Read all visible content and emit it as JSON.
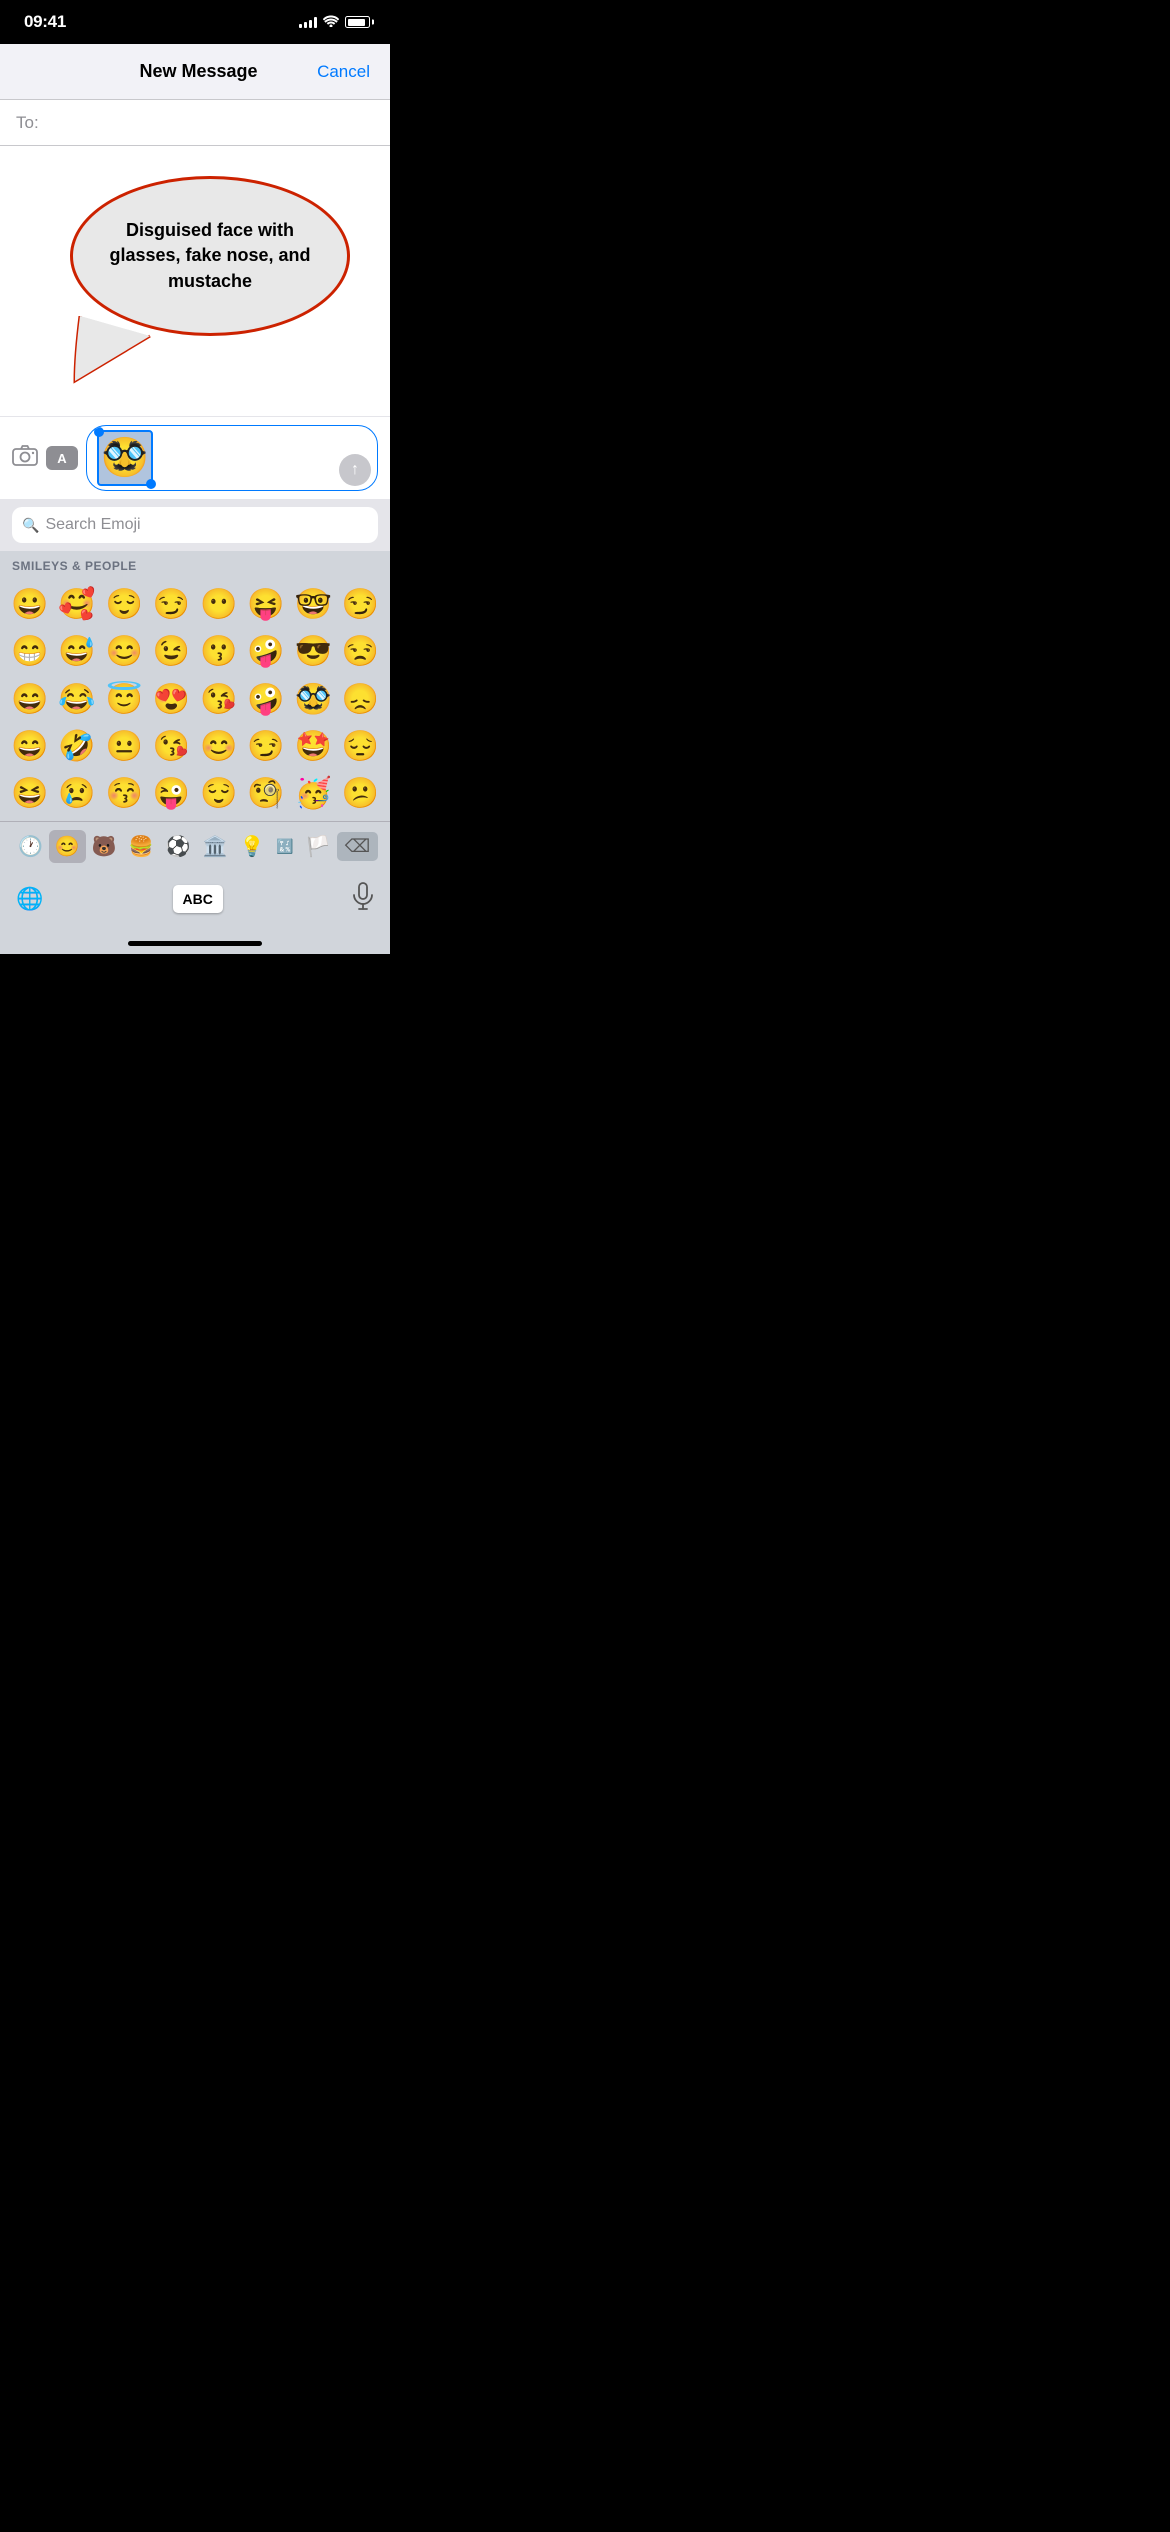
{
  "statusBar": {
    "time": "09:41",
    "signalBars": [
      4,
      6,
      8,
      10,
      12
    ],
    "batteryLevel": 85
  },
  "header": {
    "title": "New Message",
    "cancelLabel": "Cancel"
  },
  "toField": {
    "label": "To:"
  },
  "tooltip": {
    "text": "Disguised face with glasses, fake nose, and mustache"
  },
  "emojiSearch": {
    "placeholder": "Search Emoji"
  },
  "emojiCategory": {
    "label": "SMILEYS & PEOPLE"
  },
  "emojis": {
    "row1": [
      "😀",
      "🥰",
      "😌",
      "😏",
      "😶",
      "😝",
      "🤓",
      "😏"
    ],
    "row2": [
      "😁",
      "😅",
      "😊",
      "😉",
      "😗",
      "🤪",
      "😎",
      "😒"
    ],
    "row3": [
      "😄",
      "😂",
      "😇",
      "😍",
      "😘",
      "🤪",
      "🥸",
      "😞"
    ],
    "row4": [
      "😄",
      "🤣",
      "😐",
      "😘",
      "😊",
      "😏",
      "🤩",
      "😔"
    ],
    "row5": [
      "😆",
      "😢",
      "😚",
      "😜",
      "😌",
      "🧐",
      "🥳",
      "😕"
    ]
  },
  "bottomBar": {
    "recentIcon": "🕐",
    "smileyIcon": "😊",
    "animalIcon": "🐻",
    "foodIcon": "🍔",
    "sportsIcon": "⚽",
    "buildingIcon": "🏛️",
    "lightbulbIcon": "💡",
    "symbolsIcon": "🔣",
    "flagIcon": "🏳️",
    "deleteIcon": "⌫"
  },
  "keyboard": {
    "abcLabel": "ABC",
    "globeIcon": "globe",
    "micIcon": "mic"
  }
}
